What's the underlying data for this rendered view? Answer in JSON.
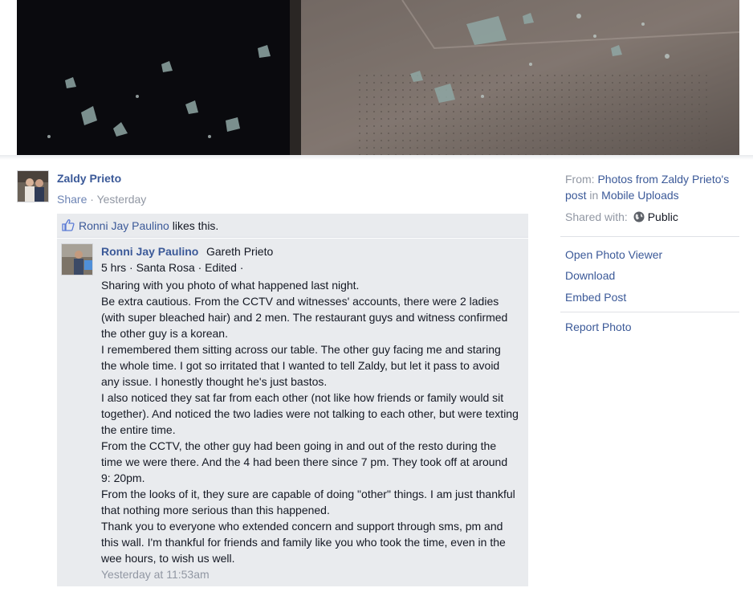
{
  "post": {
    "author": "Zaldy Prieto",
    "share_label": "Share",
    "separator": " · ",
    "time": "Yesterday"
  },
  "likes": {
    "liker": "Ronni Jay Paulino",
    "suffix": " likes this."
  },
  "comment": {
    "author": "Ronni Jay Paulino",
    "tagged": "Gareth Prieto",
    "meta": "5 hrs · Santa Rosa · Edited ·",
    "body": "Sharing with you photo of what happened last night.\nBe extra cautious. From the CCTV and witnesses' accounts, there were 2 ladies (with super bleached hair) and 2 men. The restaurant guys and witness confirmed the other guy is a korean.\nI remembered them sitting across our table. The other guy facing me and staring the whole time. I got so irritated that I wanted to tell Zaldy, but let it pass to avoid any issue. I honestly thought he's just bastos.\nI also noticed they sat far from each other (not like how friends or family would sit together). And noticed the two ladies were not talking to each other, but were texting the entire time.\nFrom the CCTV, the other guy had been going in and out of the resto during the time we were there. And the 4 had been there since 7 pm. They took off at around 9: 20pm.\nFrom the looks of it, they sure are capable of doing \"other\" things. I am just thankful that nothing more serious than this happened.\nThank you to everyone who extended concern and support through sms, pm and this wall. I'm thankful for friends and family like you who took the time, even in the wee hours, to wish us well.",
    "timestamp": "Yesterday at 11:53am"
  },
  "sidebar": {
    "from_label": "From: ",
    "from_link": "Photos from Zaldy Prieto's post",
    "in_label": " in ",
    "album_link": "Mobile Uploads",
    "shared_label": "Shared with:",
    "privacy": "Public",
    "actions": [
      "Open Photo Viewer",
      "Download",
      "Embed Post"
    ],
    "report": "Report Photo"
  },
  "colors": {
    "link": "#3b5998",
    "muted": "#9197a3",
    "comment_bg": "#e9ebee"
  },
  "icons": {
    "like": "thumbs-up-icon",
    "privacy": "globe-icon"
  }
}
